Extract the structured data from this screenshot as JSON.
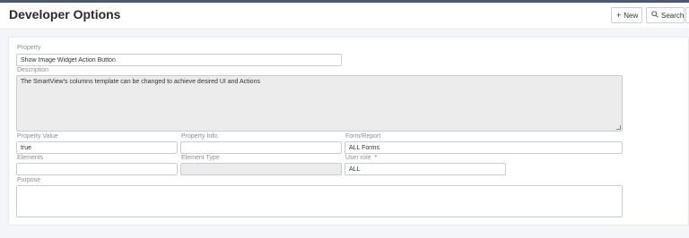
{
  "page": {
    "title": "Developer Options"
  },
  "toolbar": {
    "new_label": "New",
    "new_icon": "plus-icon",
    "search_label": "Search",
    "search_icon": "magnifier-icon"
  },
  "form": {
    "property": {
      "label": "Property",
      "value": "Show Image Widget Action Button"
    },
    "description": {
      "label": "Description",
      "value": "The SmartView's columns template can be changed to achieve desired UI and Actions"
    },
    "property_value": {
      "label": "Property Value",
      "value": "true"
    },
    "property_info": {
      "label": "Property Info.",
      "value": ""
    },
    "form_report": {
      "label": "Form/Report",
      "value": "ALL Forms"
    },
    "elements": {
      "label": "Elements",
      "value": ""
    },
    "element_type": {
      "label": "Element Type",
      "value": ""
    },
    "user_role": {
      "label": "User role",
      "required_mark": "*",
      "value": "ALL"
    },
    "purpose": {
      "label": "Purpose",
      "value": ""
    }
  },
  "colors": {
    "required": "#d9534f",
    "header_line": "#4a5a6a"
  }
}
